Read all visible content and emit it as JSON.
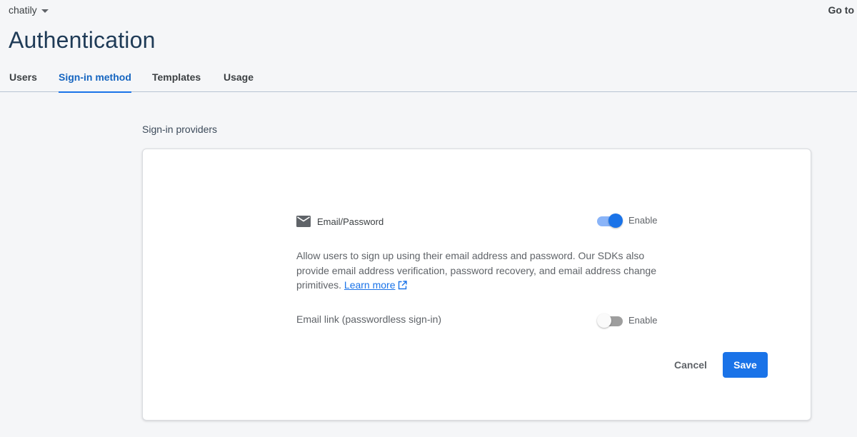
{
  "header": {
    "project_name": "chatily",
    "goto_label": "Go to",
    "title": "Authentication"
  },
  "tabs": [
    {
      "label": "Users",
      "active": false
    },
    {
      "label": "Sign-in method",
      "active": true
    },
    {
      "label": "Templates",
      "active": false
    },
    {
      "label": "Usage",
      "active": false
    }
  ],
  "section_label": "Sign-in providers",
  "provider": {
    "icon": "mail-icon",
    "name": "Email/Password",
    "enabled": true,
    "enable_label": "Enable",
    "description": "Allow users to sign up using their email address and password. Our SDKs also provide email address verification, password recovery, and email address change primitives.",
    "learn_more_label": "Learn more"
  },
  "email_link": {
    "label": "Email link (passwordless sign-in)",
    "enabled": false,
    "enable_label": "Enable"
  },
  "actions": {
    "cancel_label": "Cancel",
    "save_label": "Save"
  },
  "colors": {
    "accent": "#1a73e8",
    "toggle_on_track": "#8ab4f8",
    "page_bg": "#f5f6f8",
    "title": "#1f3b57"
  }
}
